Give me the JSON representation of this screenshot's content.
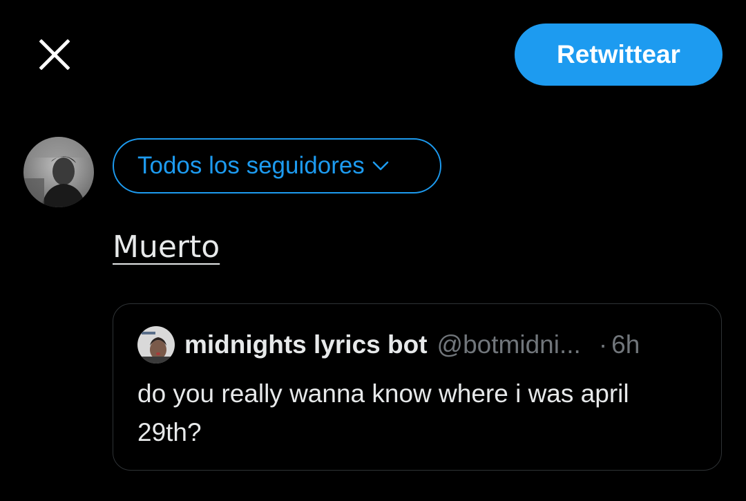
{
  "toolbar": {
    "close_icon": "close-icon",
    "retweet_label": "Retwittear",
    "accent_color": "#1d9bf0"
  },
  "composer": {
    "audience_label": "Todos los seguidores",
    "audience_icon": "chevron-down-icon",
    "text": "Muerto"
  },
  "quoted_tweet": {
    "author_name": "midnights lyrics bot",
    "handle": "@botmidni...",
    "separator": "·",
    "time": "6h",
    "text": "do you really wanna know where i was april 29th?"
  }
}
